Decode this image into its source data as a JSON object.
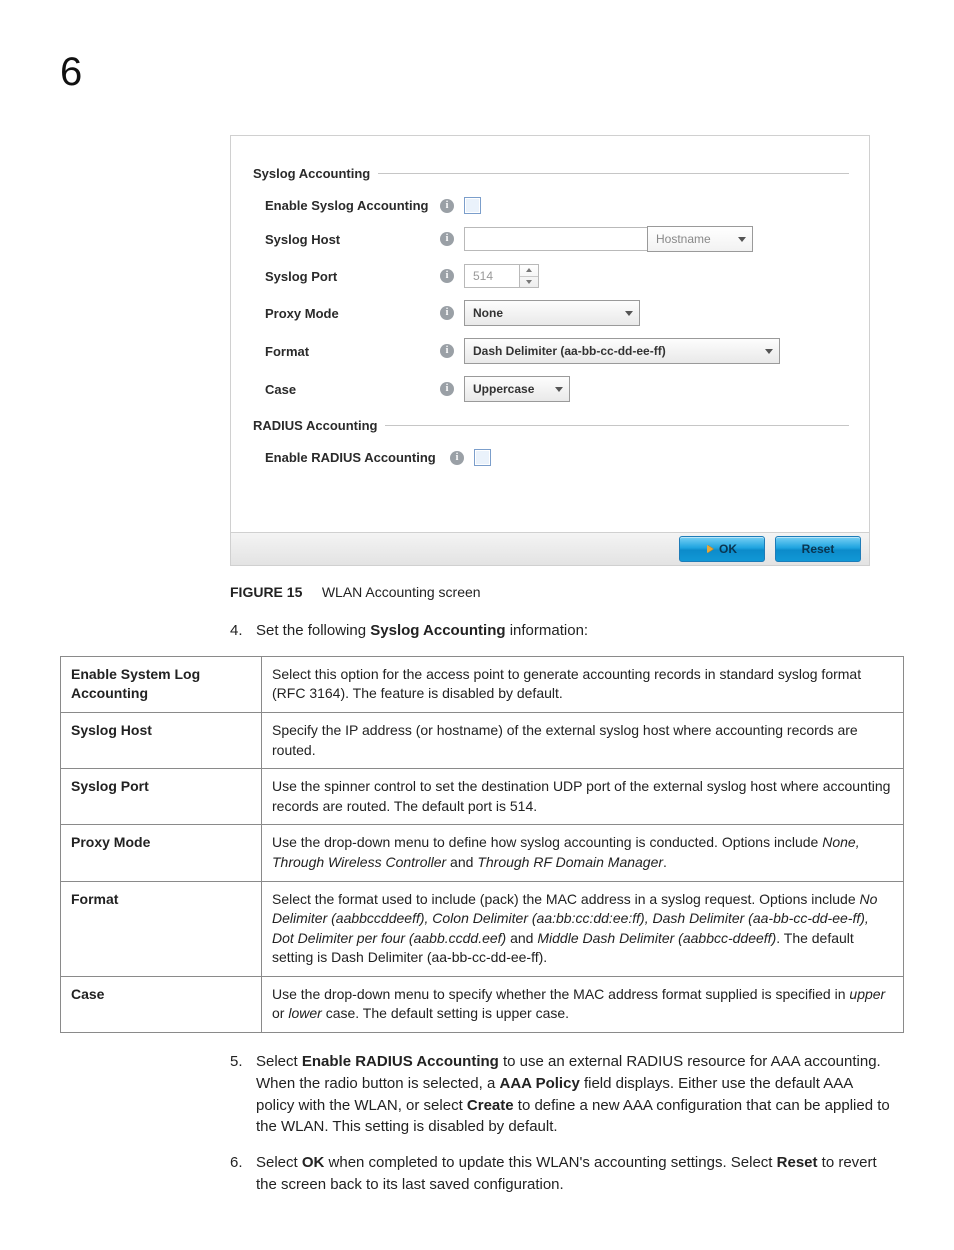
{
  "chapter": "6",
  "panel": {
    "syslog": {
      "legend": "Syslog Accounting",
      "enable": {
        "label": "Enable Syslog Accounting",
        "checked": false
      },
      "host": {
        "label": "Syslog Host",
        "value": "",
        "type_select": "Hostname"
      },
      "port": {
        "label": "Syslog Port",
        "value": "514"
      },
      "proxy": {
        "label": "Proxy Mode",
        "value": "None"
      },
      "format": {
        "label": "Format",
        "value": "Dash Delimiter (aa-bb-cc-dd-ee-ff)"
      },
      "case": {
        "label": "Case",
        "value": "Uppercase"
      }
    },
    "radius": {
      "legend": "RADIUS Accounting",
      "enable": {
        "label": "Enable RADIUS Accounting",
        "checked": false
      }
    },
    "buttons": {
      "ok": "OK",
      "reset": "Reset"
    }
  },
  "figure": {
    "num": "FIGURE 15",
    "caption": "WLAN Accounting screen"
  },
  "step4": {
    "num": "4.",
    "lead": "Set the following ",
    "bold": "Syslog Accounting",
    "tail": " information:"
  },
  "table": [
    {
      "k": "Enable System Log Accounting",
      "v": "Select this option for the access point to generate accounting records in standard syslog format (RFC 3164). The feature is disabled by default."
    },
    {
      "k": "Syslog Host",
      "v": "Specify the IP address (or hostname) of the external syslog host where accounting records are routed."
    },
    {
      "k": "Syslog Port",
      "v": "Use the spinner control to set the destination UDP port of the external syslog host where accounting records are routed. The default port is 514."
    },
    {
      "k": "Proxy Mode",
      "v_html": "Use the drop-down menu to define how syslog accounting is conducted. Options include <span class=\"i\">None, Through Wireless Controller</span> and <span class=\"i\">Through RF Domain Manager</span>."
    },
    {
      "k": "Format",
      "v_html": "Select the format used to include (pack) the MAC address in a syslog request. Options include <span class=\"i\">No Delimiter (aabbccddeeff), Colon Delimiter (aa:bb:cc:dd:ee:ff), Dash Delimiter (aa-bb-cc-dd-ee-ff), Dot Delimiter per four (aabb.ccdd.eef)</span> and <span class=\"i\">Middle Dash Delimiter (aabbcc-ddeeff)</span>. The default setting is Dash Delimiter (aa-bb-cc-dd-ee-ff)."
    },
    {
      "k": "Case",
      "v_html": "Use the drop-down menu to specify whether the MAC address format supplied is specified in <span class=\"i\">upper</span> or <span class=\"i\">lower</span> case. The default setting is upper case."
    }
  ],
  "step5": {
    "num": "5.",
    "html": "Select <span class=\"b\">Enable RADIUS Accounting</span> to use an external RADIUS resource for AAA accounting. When the radio button is selected, a <span class=\"b\">AAA Policy</span> field displays. Either use the default AAA policy with the WLAN, or select <span class=\"b\">Create</span> to define a new AAA configuration that can be applied to the WLAN. This setting is disabled by default."
  },
  "step6": {
    "num": "6.",
    "html": "Select <span class=\"b\">OK</span> when completed to update this WLAN's accounting settings. Select <span class=\"b\">Reset</span> to revert the screen back to its last saved configuration."
  }
}
